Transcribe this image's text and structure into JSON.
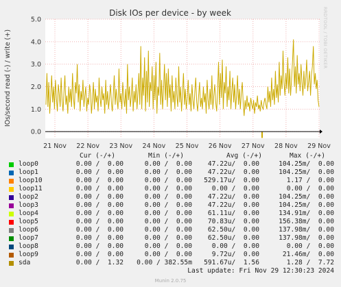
{
  "chart_data": {
    "type": "line",
    "title": "Disk IOs per device - by week",
    "ylabel": "IOs/second read (-) / write (+)",
    "ylim": [
      -0.3,
      5.0
    ],
    "yticks": [
      {
        "value": 5.0,
        "label": "5.0"
      },
      {
        "value": 4.0,
        "label": "4.0"
      },
      {
        "value": 3.0,
        "label": "3.0"
      },
      {
        "value": 2.0,
        "label": "2.0"
      },
      {
        "value": 1.0,
        "label": "1.0"
      },
      {
        "value": 0.0,
        "label": "0.0"
      }
    ],
    "xticks": [
      "21 Nov",
      "22 Nov",
      "23 Nov",
      "24 Nov",
      "25 Nov",
      "26 Nov",
      "27 Nov",
      "28 Nov",
      "29 Nov"
    ],
    "grid": true,
    "series": [
      {
        "name": "sda",
        "color": "#ccaa00",
        "values": [
          1.2,
          2.6,
          1.1,
          2.2,
          0.8,
          1.6,
          2.5,
          1.3,
          2.0,
          1.0,
          2.3,
          1.5,
          0.9,
          2.1,
          1.7,
          1.1,
          2.4,
          1.4,
          0.9,
          1.8,
          2.5,
          1.2,
          1.6,
          0.8,
          2.0,
          1.3,
          1.9,
          1.1,
          2.6,
          1.5,
          1.0,
          2.2,
          1.7,
          3.0,
          1.3,
          2.1,
          0.9,
          1.8,
          1.4,
          2.3,
          1.1,
          1.6,
          2.0,
          0.9,
          1.5,
          1.2,
          2.1,
          1.7,
          0.8,
          1.4,
          2.2,
          1.0,
          1.9,
          1.3,
          1.6,
          0.9,
          2.4,
          1.5,
          1.1,
          2.0,
          1.4,
          1.7,
          0.8,
          2.3,
          1.2,
          1.8,
          1.0,
          1.5,
          2.1,
          1.3,
          0.9,
          1.6,
          2.5,
          1.2,
          1.9,
          1.4,
          1.0,
          2.8,
          1.3,
          1.7,
          1.0,
          2.2,
          1.5,
          1.1,
          1.9,
          0.8,
          3.0,
          1.4,
          2.0,
          1.1,
          1.6,
          2.4,
          0.9,
          1.8,
          1.3,
          2.1,
          1.0,
          1.7,
          2.6,
          1.2,
          3.8,
          1.0,
          2.4,
          1.6,
          3.3,
          0.9,
          2.7,
          1.3,
          3.6,
          1.1,
          2.2,
          1.8,
          2.9,
          1.0,
          2.5,
          1.4,
          3.1,
          0.8,
          2.0,
          1.6,
          3.5,
          1.2,
          2.3,
          1.0,
          1.9,
          3.0,
          1.4,
          2.6,
          1.1,
          2.8,
          1.5,
          2.1,
          0.9,
          2.5,
          1.3,
          1.8,
          1.0,
          2.4,
          1.6,
          1.1,
          2.9,
          1.3,
          2.0,
          0.9,
          1.7,
          2.6,
          1.2,
          1.9,
          1.0,
          1.5,
          2.3,
          1.2,
          1.7,
          0.9,
          2.1,
          1.4,
          1.0,
          1.8,
          2.4,
          1.3,
          0.9,
          1.6,
          2.2,
          1.1,
          1.5,
          1.0,
          2.0,
          1.3,
          1.7,
          0.8,
          2.3,
          1.4,
          1.0,
          1.9,
          1.2,
          2.5,
          1.0,
          1.6,
          2.1,
          1.3,
          0.9,
          1.8,
          3.1,
          1.2,
          2.6,
          1.5,
          3.2,
          1.0,
          2.2,
          1.7,
          2.9,
          1.1,
          2.0,
          1.4,
          2.7,
          1.0,
          1.8,
          2.4,
          1.3,
          2.1,
          1.0,
          1.6,
          2.5,
          1.2,
          1.9,
          1.0,
          1.7,
          2.2,
          1.3,
          0.7,
          1.4,
          1.0,
          1.6,
          1.1,
          1.3,
          0.9,
          1.5,
          1.2,
          1.0,
          1.4,
          0.8,
          1.3,
          1.1,
          1.6,
          1.0,
          1.2,
          0.9,
          1.4,
          1.1,
          1.0,
          1.3,
          1.5,
          1.2,
          1.0,
          2.0,
          1.3,
          1.8,
          1.1,
          2.4,
          1.4,
          1.9,
          1.2,
          2.7,
          1.5,
          2.1,
          1.3,
          3.1,
          1.6,
          2.5,
          1.9,
          3.6,
          2.2,
          1.6,
          2.6,
          1.9,
          3.3,
          1.7,
          2.8,
          1.6,
          2.3,
          3.1,
          4.1,
          2.0,
          2.9,
          1.7,
          3.4,
          2.1,
          2.6,
          1.8,
          3.0,
          2.2,
          1.6,
          2.7,
          1.9,
          2.4,
          3.2,
          1.8,
          2.2,
          2.7,
          1.6,
          2.5,
          2.9,
          3.8,
          2.1,
          2.6,
          1.9,
          2.3,
          1.4,
          1.1
        ]
      },
      {
        "name": "sda_read",
        "color": "#ccaa00",
        "dip": {
          "x_frac": 0.79,
          "value": -0.28
        }
      }
    ]
  },
  "legend": {
    "headers": {
      "cur": "Cur (-/+)",
      "min": "Min (-/+)",
      "avg": "Avg (-/+)",
      "max": "Max (-/+)"
    },
    "rows": [
      {
        "name": "loop0",
        "color": "#00cc00",
        "cur": "0.00 /  0.00",
        "min": "0.00 /  0.00",
        "avg": "47.22u/  0.00",
        "max": "104.25m/  0.00"
      },
      {
        "name": "loop1",
        "color": "#0066b3",
        "cur": "0.00 /  0.00",
        "min": "0.00 /  0.00",
        "avg": "47.22u/  0.00",
        "max": "104.25m/  0.00"
      },
      {
        "name": "loop10",
        "color": "#ff8000",
        "cur": "0.00 /  0.00",
        "min": "0.00 /  0.00",
        "avg": "529.17u/  0.00",
        "max": "1.17 /  0.00"
      },
      {
        "name": "loop11",
        "color": "#ffcc00",
        "cur": "0.00 /  0.00",
        "min": "0.00 /  0.00",
        "avg": "0.00 /  0.00",
        "max": "0.00 /  0.00"
      },
      {
        "name": "loop2",
        "color": "#330099",
        "cur": "0.00 /  0.00",
        "min": "0.00 /  0.00",
        "avg": "47.22u/  0.00",
        "max": "104.25m/  0.00"
      },
      {
        "name": "loop3",
        "color": "#990099",
        "cur": "0.00 /  0.00",
        "min": "0.00 /  0.00",
        "avg": "47.22u/  0.00",
        "max": "104.25m/  0.00"
      },
      {
        "name": "loop4",
        "color": "#ccff00",
        "cur": "0.00 /  0.00",
        "min": "0.00 /  0.00",
        "avg": "61.11u/  0.00",
        "max": "134.91m/  0.00"
      },
      {
        "name": "loop5",
        "color": "#ff0000",
        "cur": "0.00 /  0.00",
        "min": "0.00 /  0.00",
        "avg": "70.83u/  0.00",
        "max": "156.38m/  0.00"
      },
      {
        "name": "loop6",
        "color": "#808080",
        "cur": "0.00 /  0.00",
        "min": "0.00 /  0.00",
        "avg": "62.50u/  0.00",
        "max": "137.98m/  0.00"
      },
      {
        "name": "loop7",
        "color": "#008f00",
        "cur": "0.00 /  0.00",
        "min": "0.00 /  0.00",
        "avg": "62.50u/  0.00",
        "max": "137.98m/  0.00"
      },
      {
        "name": "loop8",
        "color": "#00487d",
        "cur": "0.00 /  0.00",
        "min": "0.00 /  0.00",
        "avg": "0.00 /  0.00",
        "max": "0.00 /  0.00"
      },
      {
        "name": "loop9",
        "color": "#b35a00",
        "cur": "0.00 /  0.00",
        "min": "0.00 /  0.00",
        "avg": "9.72u/  0.00",
        "max": "21.46m/  0.00"
      },
      {
        "name": "sda",
        "color": "#b38f00",
        "cur": "0.00 /  1.32",
        "min": "0.00 / 382.55m",
        "avg": "591.67u/  1.56",
        "max": "1.28 /  7.72"
      }
    ]
  },
  "footer": {
    "last_update": "Last update: Fri Nov 29 12:30:23 2024",
    "munin": "Munin 2.0.75"
  },
  "watermark": "RRDTOOL / TOBI OETIKER"
}
